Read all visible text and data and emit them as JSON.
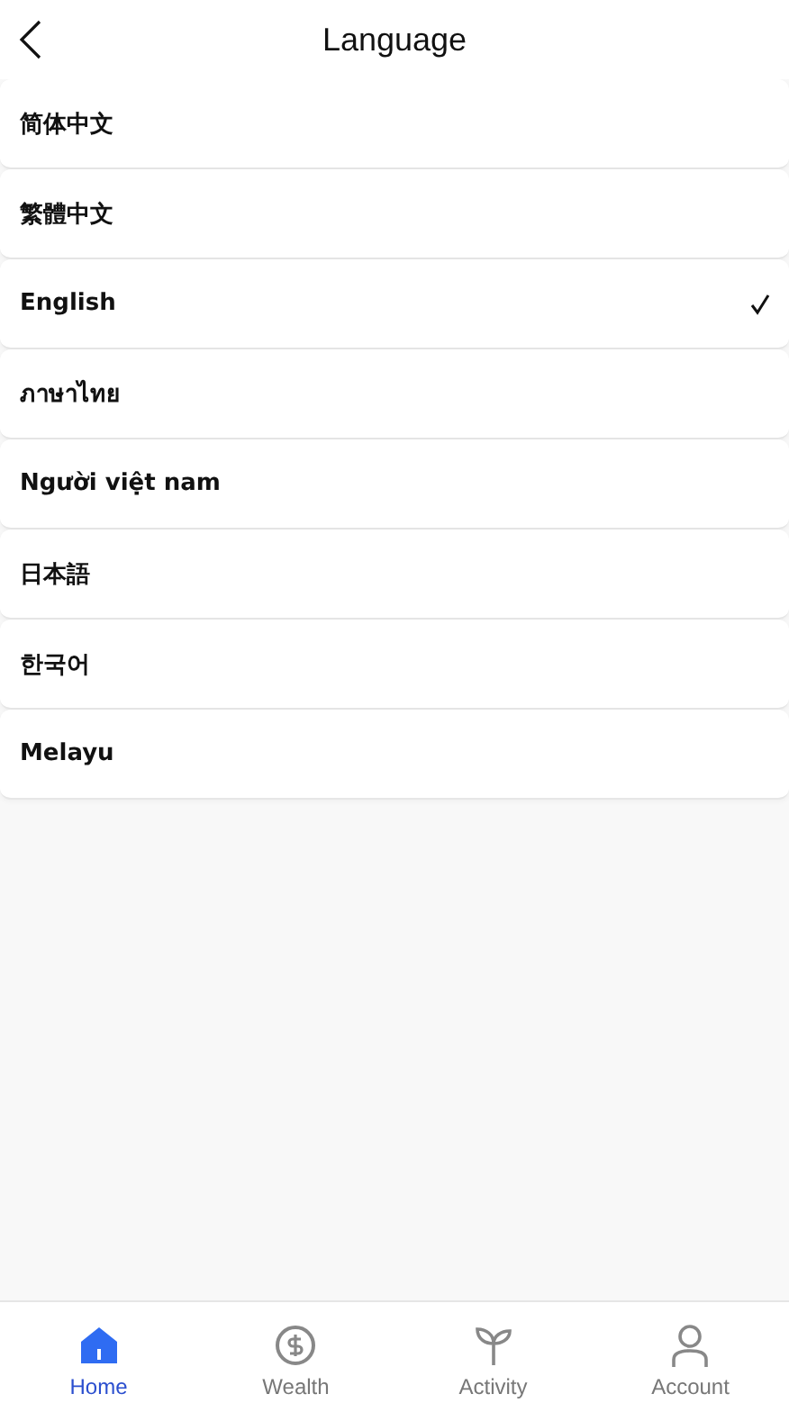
{
  "header": {
    "title": "Language"
  },
  "languages": [
    {
      "label": "简体中文",
      "selected": false
    },
    {
      "label": "繁體中文",
      "selected": false
    },
    {
      "label": "English",
      "selected": true
    },
    {
      "label": "ภาษาไทย",
      "selected": false
    },
    {
      "label": "Người việt nam",
      "selected": false
    },
    {
      "label": "日本語",
      "selected": false
    },
    {
      "label": "한국어",
      "selected": false
    },
    {
      "label": "Melayu",
      "selected": false
    }
  ],
  "tab_bar": [
    {
      "label": "Home",
      "selected": true
    },
    {
      "label": "Wealth",
      "selected": false
    },
    {
      "label": "Activity",
      "selected": false
    },
    {
      "label": "Account",
      "selected": false
    }
  ]
}
